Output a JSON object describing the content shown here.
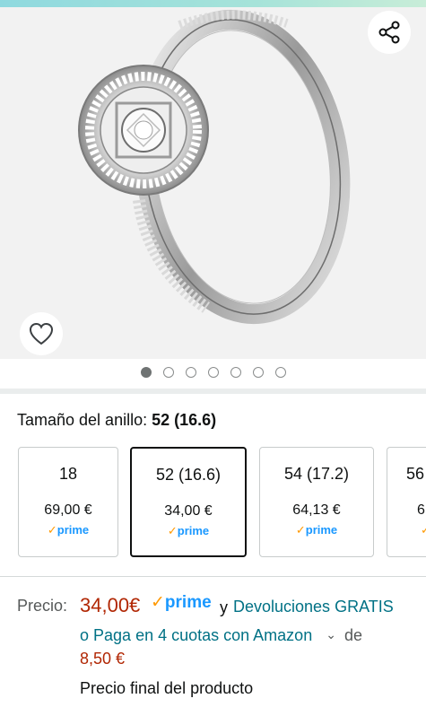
{
  "product_image": {
    "alt_subject": "ring",
    "carousel": {
      "total": 7,
      "active": 1
    }
  },
  "icons": {
    "share": "share-icon",
    "wishlist": "heart-outline-icon",
    "expand": "chevron-down-icon"
  },
  "size_selector": {
    "label": "Tamaño del anillo:",
    "selected_value": "52 (16.6)",
    "options": [
      {
        "size": "18",
        "price": "69,00 €",
        "prime": "prime",
        "selected": false
      },
      {
        "size": "52 (16.6)",
        "price": "34,00 €",
        "prime": "prime",
        "selected": true
      },
      {
        "size": "54 (17.2)",
        "price": "64,13 €",
        "prime": "prime",
        "selected": false
      },
      {
        "size": "56",
        "price": "6",
        "prime": "",
        "selected": false
      }
    ]
  },
  "pricing": {
    "label": "Precio:",
    "value": "34,00€",
    "prime_badge": "prime",
    "connector": "y",
    "returns_link": "Devoluciones GRATIS",
    "installments_prefix": "o",
    "installments_link": "Paga en 4 cuotas con Amazon",
    "installments_de": "de",
    "installments_amount": "8,50 €",
    "final_note": "Precio final del producto"
  },
  "colors": {
    "price_red": "#b12704",
    "link_teal": "#007185",
    "prime_blue": "#1a98ff",
    "prime_check": "#ff9900"
  }
}
